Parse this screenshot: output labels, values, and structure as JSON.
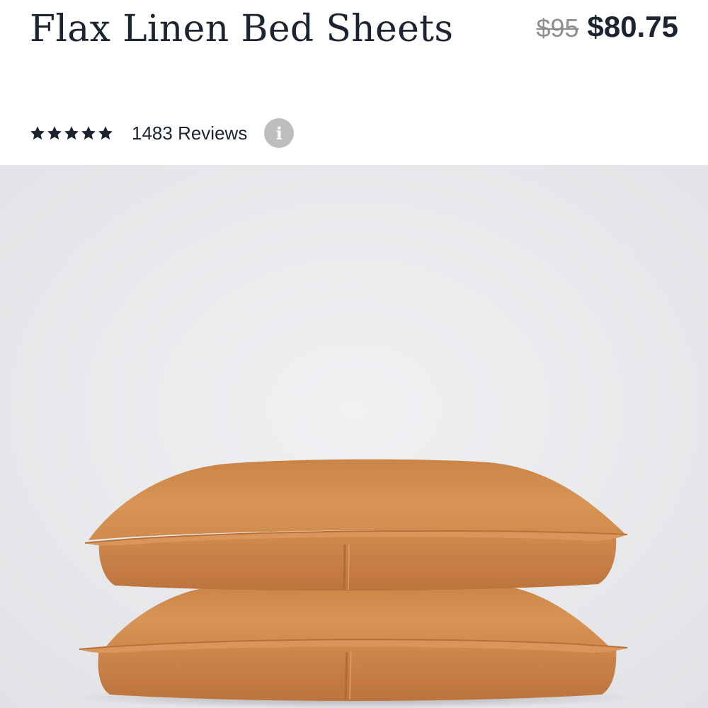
{
  "product": {
    "title": "Flax Linen Bed Sheets",
    "price_original": "$95",
    "price_sale": "$80.75",
    "reviews_label": "1483 Reviews",
    "rating": 5,
    "rating_max": 5,
    "info_icon": "info-icon",
    "info_glyph": "i",
    "image_subject": "two stacked rust-orange linen pillows on light grey backdrop"
  },
  "colors": {
    "text": "#1b2430",
    "price_original": "#8e8e8e",
    "info_badge": "#bdbdbd",
    "backdrop": "#e9eaec",
    "pillow": "#cf8a4c"
  }
}
